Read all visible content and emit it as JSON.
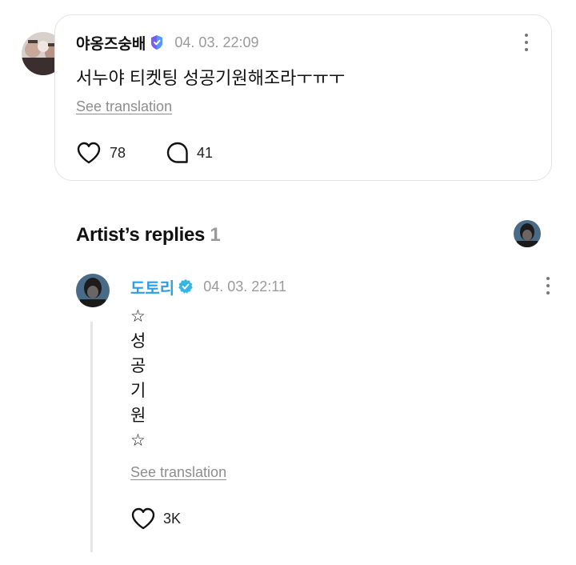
{
  "comment": {
    "author": "야옹즈숭배",
    "timestamp": "04. 03. 22:09",
    "text": "서누야 티켓팅 성공기원해조라ㅜㅠㅜ",
    "see_translation": "See translation",
    "likes": "78",
    "replies": "41"
  },
  "artist_replies": {
    "title": "Artist’s replies",
    "count": "1"
  },
  "reply": {
    "author": "도토리",
    "timestamp": "04. 03. 22:11",
    "lines": [
      "☆",
      "성",
      "공",
      "기",
      "원",
      "☆"
    ],
    "see_translation": "See translation",
    "likes": "3K"
  },
  "colors": {
    "artist_name": "#2f9ee0",
    "verified_badge_blue": "#33b6e6",
    "fan_badge": "#7b5cf0",
    "muted_text": "#9a9a9a",
    "card_border": "#e3e3e3"
  },
  "icons": [
    "fan-badge-icon",
    "verified-badge-icon",
    "heart-icon",
    "comment-bubble-icon",
    "more-options-icon"
  ]
}
